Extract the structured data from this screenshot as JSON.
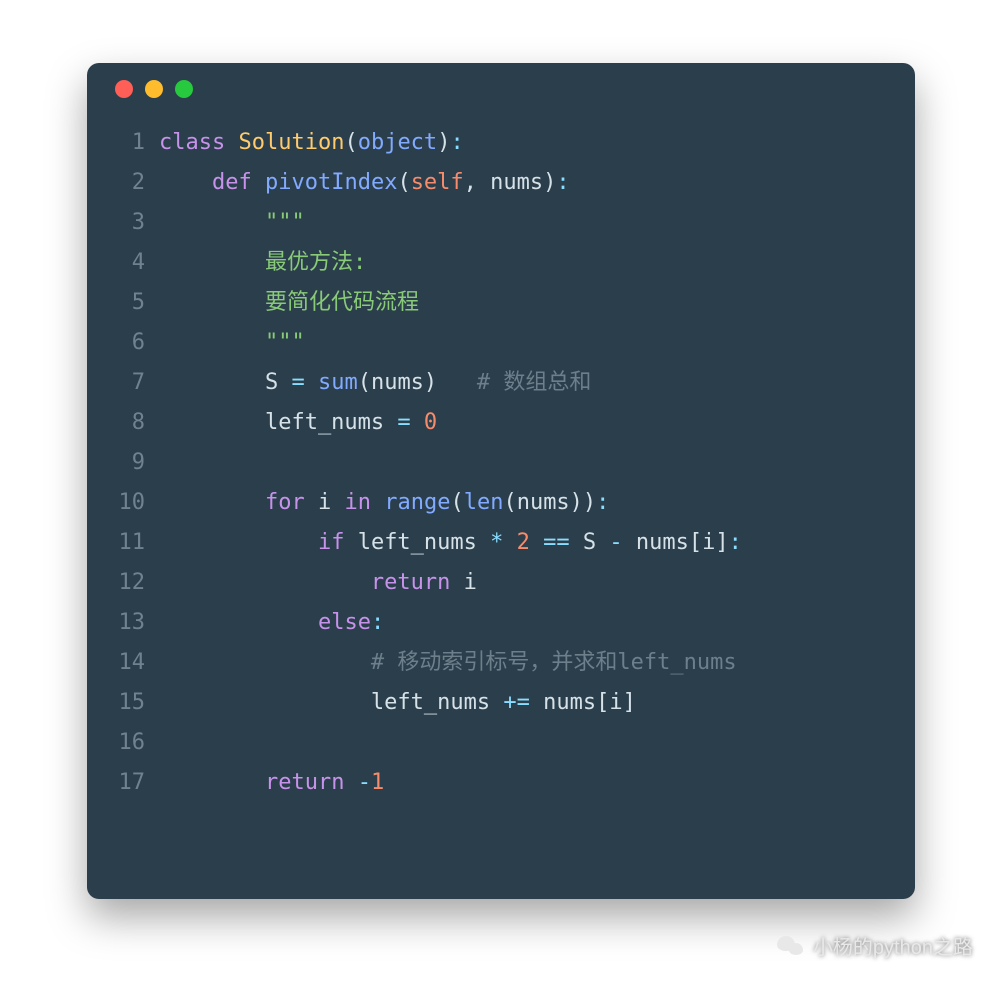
{
  "footer_text": "小杨的python之路",
  "lines": [
    {
      "n": "1",
      "segs": [
        {
          "c": "kw",
          "t": "class"
        },
        {
          "c": "pln",
          "t": " "
        },
        {
          "c": "cls",
          "t": "Solution"
        },
        {
          "c": "pln",
          "t": "("
        },
        {
          "c": "fn",
          "t": "object"
        },
        {
          "c": "pln",
          "t": ")"
        },
        {
          "c": "op",
          "t": ":"
        }
      ]
    },
    {
      "n": "2",
      "segs": [
        {
          "c": "pln",
          "t": "    "
        },
        {
          "c": "kw",
          "t": "def"
        },
        {
          "c": "pln",
          "t": " "
        },
        {
          "c": "fn",
          "t": "pivotIndex"
        },
        {
          "c": "pln",
          "t": "("
        },
        {
          "c": "num",
          "t": "self"
        },
        {
          "c": "pln",
          "t": ", nums)"
        },
        {
          "c": "op",
          "t": ":"
        }
      ]
    },
    {
      "n": "3",
      "segs": [
        {
          "c": "pln",
          "t": "        "
        },
        {
          "c": "str",
          "t": "\"\"\""
        }
      ]
    },
    {
      "n": "4",
      "segs": [
        {
          "c": "pln",
          "t": "        "
        },
        {
          "c": "str",
          "t": "最优方法:"
        }
      ]
    },
    {
      "n": "5",
      "segs": [
        {
          "c": "pln",
          "t": "        "
        },
        {
          "c": "str",
          "t": "要简化代码流程"
        }
      ]
    },
    {
      "n": "6",
      "segs": [
        {
          "c": "pln",
          "t": "        "
        },
        {
          "c": "str",
          "t": "\"\"\""
        }
      ]
    },
    {
      "n": "7",
      "segs": [
        {
          "c": "pln",
          "t": "        S "
        },
        {
          "c": "op",
          "t": "="
        },
        {
          "c": "pln",
          "t": " "
        },
        {
          "c": "fn",
          "t": "sum"
        },
        {
          "c": "pln",
          "t": "(nums)   "
        },
        {
          "c": "cm",
          "t": "# 数组总和"
        }
      ]
    },
    {
      "n": "8",
      "segs": [
        {
          "c": "pln",
          "t": "        left_nums "
        },
        {
          "c": "op",
          "t": "="
        },
        {
          "c": "pln",
          "t": " "
        },
        {
          "c": "num",
          "t": "0"
        }
      ]
    },
    {
      "n": "9",
      "segs": [
        {
          "c": "pln",
          "t": ""
        }
      ]
    },
    {
      "n": "10",
      "segs": [
        {
          "c": "pln",
          "t": "        "
        },
        {
          "c": "kw",
          "t": "for"
        },
        {
          "c": "pln",
          "t": " i "
        },
        {
          "c": "kw",
          "t": "in"
        },
        {
          "c": "pln",
          "t": " "
        },
        {
          "c": "fn",
          "t": "range"
        },
        {
          "c": "pln",
          "t": "("
        },
        {
          "c": "fn",
          "t": "len"
        },
        {
          "c": "pln",
          "t": "(nums))"
        },
        {
          "c": "op",
          "t": ":"
        }
      ]
    },
    {
      "n": "11",
      "segs": [
        {
          "c": "pln",
          "t": "            "
        },
        {
          "c": "kw",
          "t": "if"
        },
        {
          "c": "pln",
          "t": " left_nums "
        },
        {
          "c": "op",
          "t": "*"
        },
        {
          "c": "pln",
          "t": " "
        },
        {
          "c": "num",
          "t": "2"
        },
        {
          "c": "pln",
          "t": " "
        },
        {
          "c": "op",
          "t": "=="
        },
        {
          "c": "pln",
          "t": " S "
        },
        {
          "c": "op",
          "t": "-"
        },
        {
          "c": "pln",
          "t": " nums[i]"
        },
        {
          "c": "op",
          "t": ":"
        }
      ]
    },
    {
      "n": "12",
      "segs": [
        {
          "c": "pln",
          "t": "                "
        },
        {
          "c": "kw",
          "t": "return"
        },
        {
          "c": "pln",
          "t": " i"
        }
      ]
    },
    {
      "n": "13",
      "segs": [
        {
          "c": "pln",
          "t": "            "
        },
        {
          "c": "kw",
          "t": "else"
        },
        {
          "c": "op",
          "t": ":"
        }
      ]
    },
    {
      "n": "14",
      "segs": [
        {
          "c": "pln",
          "t": "                "
        },
        {
          "c": "cm",
          "t": "# 移动索引标号，并求和left_nums"
        }
      ]
    },
    {
      "n": "15",
      "segs": [
        {
          "c": "pln",
          "t": "                left_nums "
        },
        {
          "c": "op",
          "t": "+="
        },
        {
          "c": "pln",
          "t": " nums[i]"
        }
      ]
    },
    {
      "n": "16",
      "segs": [
        {
          "c": "pln",
          "t": ""
        }
      ]
    },
    {
      "n": "17",
      "segs": [
        {
          "c": "pln",
          "t": "        "
        },
        {
          "c": "kw",
          "t": "return"
        },
        {
          "c": "pln",
          "t": " "
        },
        {
          "c": "op",
          "t": "-"
        },
        {
          "c": "num",
          "t": "1"
        }
      ]
    }
  ]
}
